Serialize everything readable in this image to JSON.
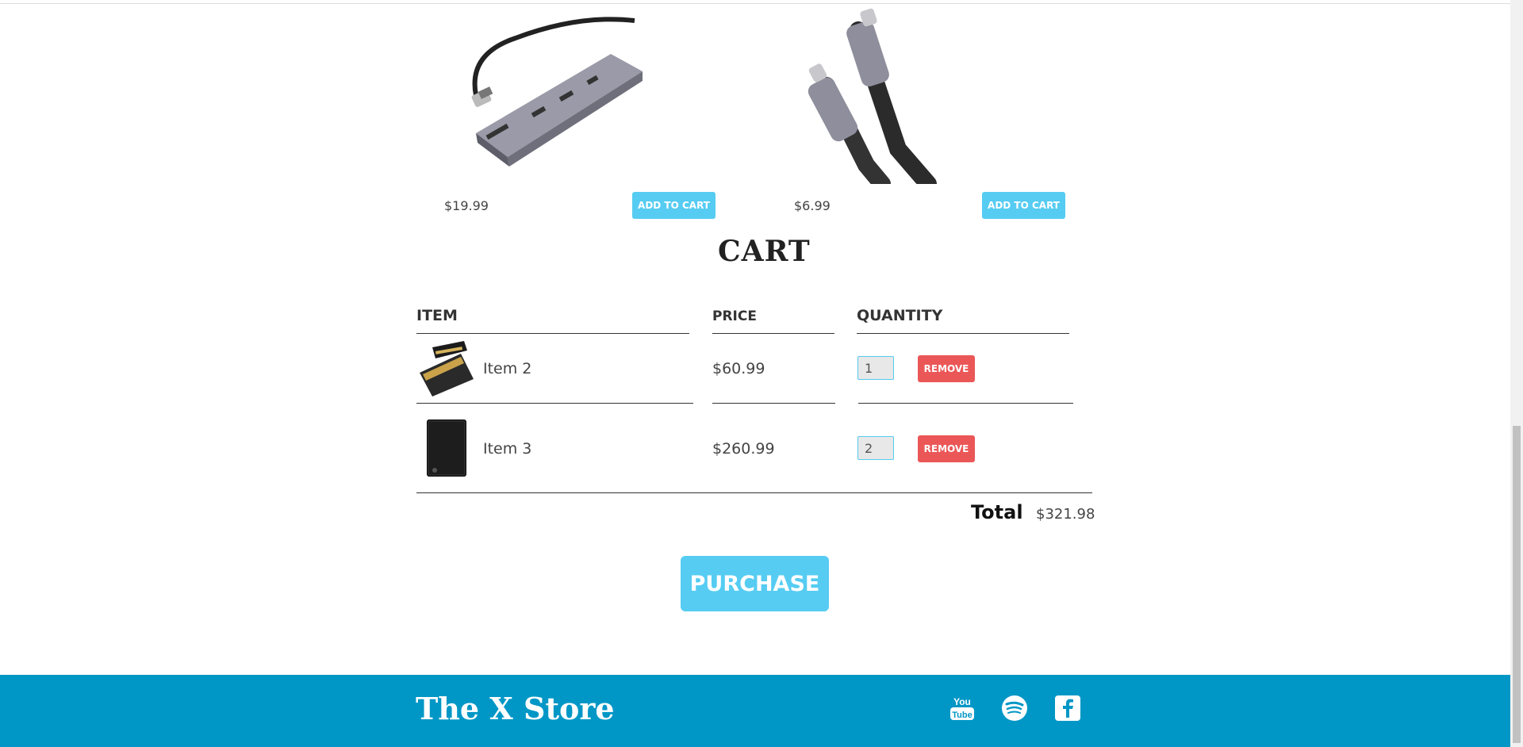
{
  "products": [
    {
      "price": "$19.99",
      "add_label": "ADD TO CART",
      "image": "usb-c-hub"
    },
    {
      "price": "$6.99",
      "add_label": "ADD TO CART",
      "image": "usb-c-cable"
    }
  ],
  "cart": {
    "title": "CART",
    "columns": {
      "item": "ITEM",
      "price": "PRICE",
      "quantity": "QUANTITY"
    },
    "items": [
      {
        "name": "Item 2",
        "price": "$60.99",
        "quantity": "1",
        "remove_label": "REMOVE",
        "image": "riser-card"
      },
      {
        "name": "Item 3",
        "price": "$260.99",
        "quantity": "2",
        "remove_label": "REMOVE",
        "image": "hard-drive"
      }
    ],
    "total_label": "Total",
    "total_value": "$321.98",
    "purchase_label": "PURCHASE"
  },
  "footer": {
    "brand": "The X Store",
    "social": [
      "youtube-icon",
      "spotify-icon",
      "facebook-icon"
    ],
    "youtube_top": "You",
    "youtube_bottom": "Tube"
  },
  "colors": {
    "accent": "#56ccf2",
    "danger": "#eb5757",
    "footer": "#0097c6"
  }
}
